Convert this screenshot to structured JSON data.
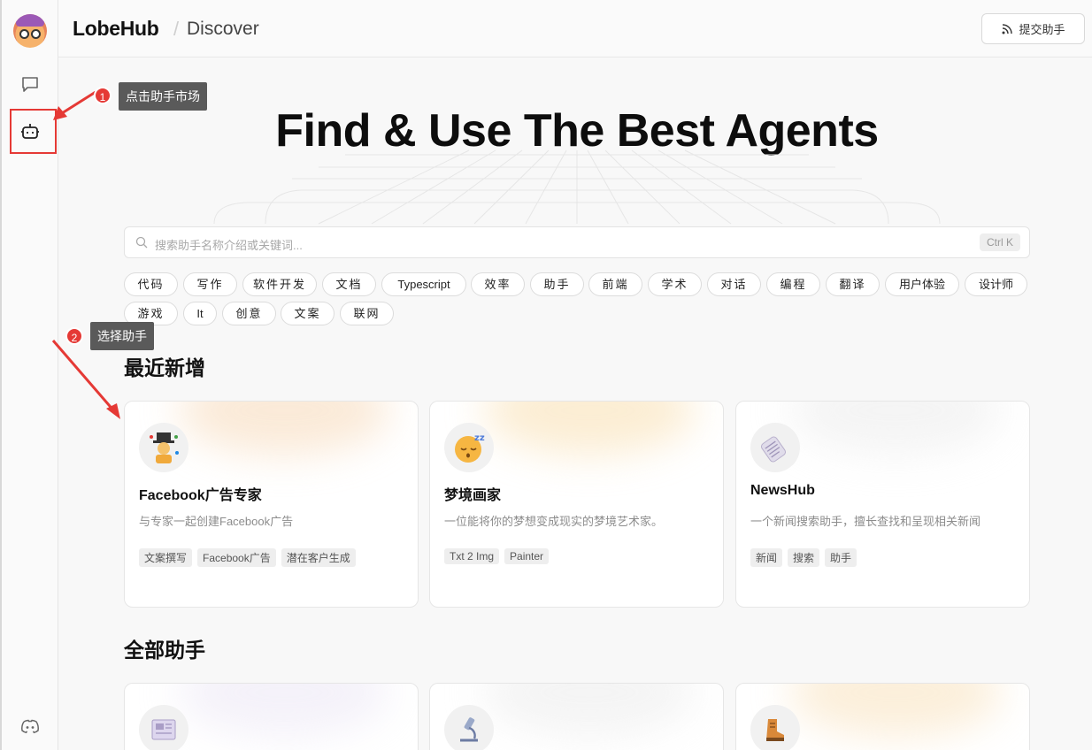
{
  "header": {
    "brand": "LobeHub",
    "slash": "/",
    "section": "Discover",
    "submit_label": "提交助手"
  },
  "hero": {
    "title": "Find & Use The Best Agents"
  },
  "search": {
    "placeholder": "搜索助手名称介绍或关键词...",
    "shortcut": "Ctrl K"
  },
  "tags": [
    "代码",
    "写作",
    "软件开发",
    "文档",
    "Typescript",
    "效率",
    "助手",
    "前端",
    "学术",
    "对话",
    "编程",
    "翻译",
    "用户体验",
    "设计师",
    "游戏",
    "It",
    "创意",
    "文案",
    "联网"
  ],
  "sections": {
    "recent": "最近新增",
    "all": "全部助手"
  },
  "recent_cards": [
    {
      "title": "Facebook广告专家",
      "desc": "与专家一起创建Facebook广告",
      "tags": [
        "文案撰写",
        "Facebook广告",
        "潜在客户生成"
      ],
      "icon": "ringmaster-emoji"
    },
    {
      "title": "梦境画家",
      "desc": "一位能将你的梦想变成现实的梦境艺术家。",
      "tags": [
        "Txt 2 Img",
        "Painter"
      ],
      "icon": "sleeping-face-emoji"
    },
    {
      "title": "NewsHub",
      "desc": "一个新闻搜索助手，擅长查找和呈现相关新闻",
      "tags": [
        "新闻",
        "搜索",
        "助手"
      ],
      "icon": "rolled-newspaper-emoji"
    }
  ],
  "annotations": [
    {
      "num": "1",
      "text": "点击助手市场"
    },
    {
      "num": "2",
      "text": "选择助手"
    }
  ],
  "colors": {
    "annotation_red": "#e53935",
    "annotation_box": "#5a5a5a"
  }
}
